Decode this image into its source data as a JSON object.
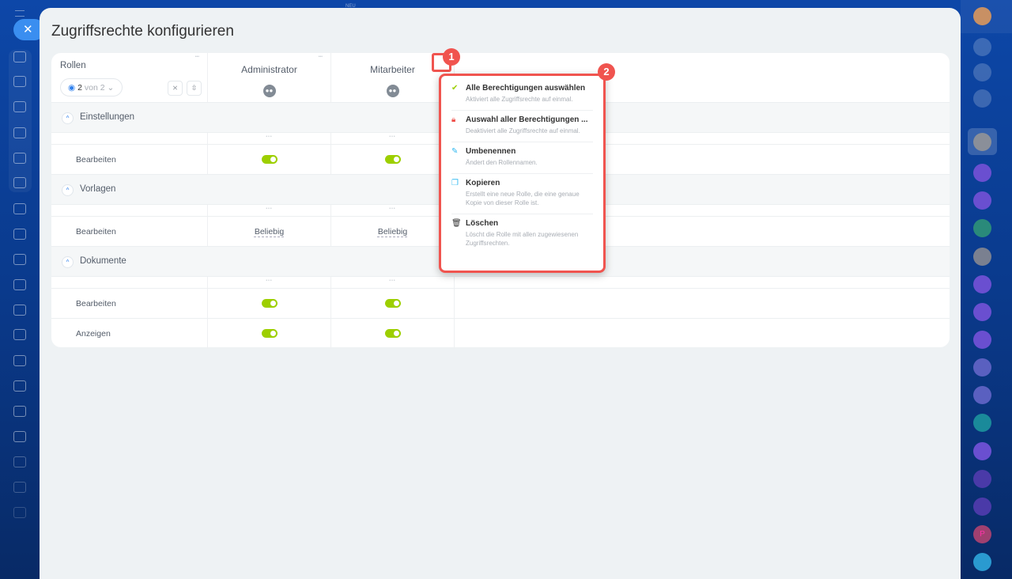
{
  "top_label": "NEU",
  "title": "Zugriffsrechte konfigurieren",
  "header": {
    "roles_label": "Rollen",
    "visible_count": "2",
    "visible_of": "von 2",
    "columns": [
      {
        "name": "Administrator"
      },
      {
        "name": "Mitarbeiter"
      }
    ]
  },
  "sections": [
    {
      "name": "Einstellungen",
      "items": [
        {
          "label": "Bearbeiten",
          "type": "toggle",
          "values": [
            true,
            true
          ]
        }
      ]
    },
    {
      "name": "Vorlagen",
      "items": [
        {
          "label": "Bearbeiten",
          "type": "select",
          "values": [
            "Beliebig",
            "Beliebig"
          ]
        }
      ]
    },
    {
      "name": "Dokumente",
      "items": [
        {
          "label": "Bearbeiten",
          "type": "toggle",
          "values": [
            true,
            true
          ]
        },
        {
          "label": "Anzeigen",
          "type": "toggle",
          "values": [
            true,
            true
          ]
        }
      ]
    }
  ],
  "menu": [
    {
      "icon": "check-icon",
      "title": "Alle Berechtigungen auswählen",
      "desc": "Aktiviert alle Zugriffsrechte auf einmal."
    },
    {
      "icon": "lock-icon",
      "title": "Auswahl aller Berechtigungen ...",
      "desc": "Deaktiviert alle Zugriffsrechte auf einmal."
    },
    {
      "icon": "pencil-icon",
      "title": "Umbenennen",
      "desc": "Ändert den Rollennamen."
    },
    {
      "icon": "copy-icon",
      "title": "Kopieren",
      "desc": "Erstellt eine neue Rolle, die eine genaue Kopie von dieser Rolle ist."
    },
    {
      "icon": "trash-icon",
      "title": "Löschen",
      "desc": "Löscht die Rolle mit allen zugewiesenen Zugriffsrechten."
    }
  ],
  "badges": [
    "1",
    "2"
  ],
  "right_bar": {
    "letter_avatar": "P"
  },
  "colors": {
    "toggle_on": "#9dcf00",
    "callout": "#f0544f",
    "accent": "#2f80ed"
  }
}
